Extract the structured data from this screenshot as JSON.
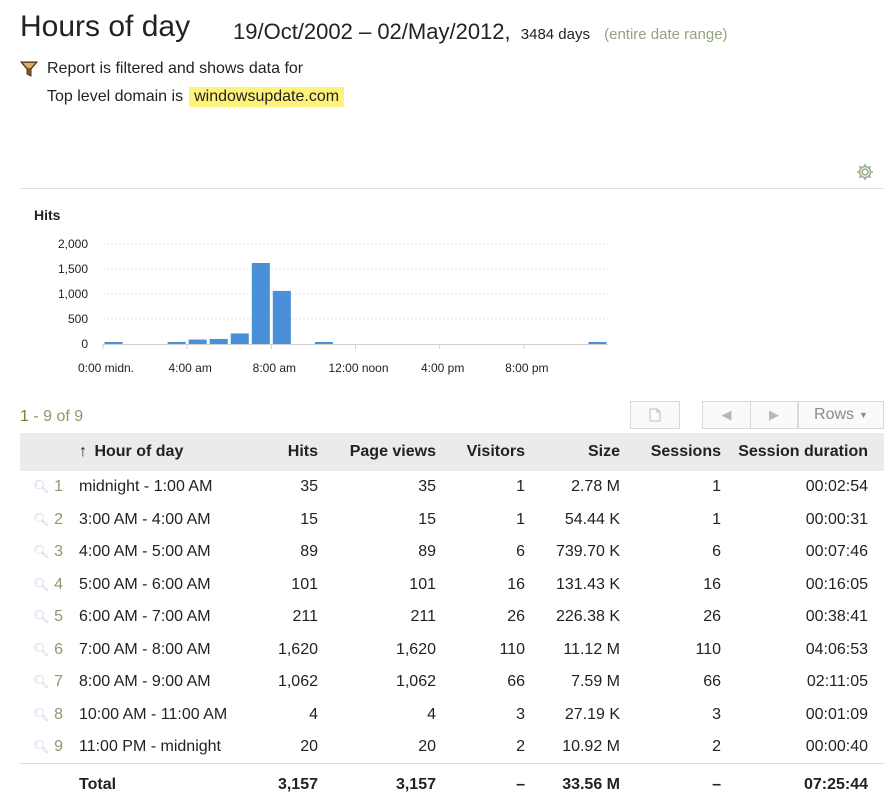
{
  "header": {
    "title": "Hours of day",
    "date_range": "19/Oct/2002 – 02/May/2012,",
    "days": "3484 days",
    "entire_range_link": "(entire date range)"
  },
  "filter": {
    "icon": "funnel-icon",
    "line1": "Report is filtered and shows data for",
    "line2_label": "Top level domain is",
    "value": "windowsupdate.com",
    "highlight_color": "#fff27a"
  },
  "chart_data": {
    "type": "bar",
    "title": "Hits",
    "xlabel": "",
    "ylabel": "",
    "ylim": [
      0,
      2000
    ],
    "yticks": [
      "2,000",
      "1,500",
      "1,000",
      "500",
      "0"
    ],
    "xtick_labels": [
      "0:00 midn.",
      "4:00 am",
      "8:00 am",
      "12:00 noon",
      "4:00 pm",
      "8:00 pm"
    ],
    "categories": [
      "0",
      "1",
      "2",
      "3",
      "4",
      "5",
      "6",
      "7",
      "8",
      "9",
      "10",
      "11",
      "12",
      "13",
      "14",
      "15",
      "16",
      "17",
      "18",
      "19",
      "20",
      "21",
      "22",
      "23"
    ],
    "values": [
      35,
      0,
      0,
      15,
      89,
      101,
      211,
      1620,
      1062,
      0,
      4,
      0,
      0,
      0,
      0,
      0,
      0,
      0,
      0,
      0,
      0,
      0,
      0,
      20
    ],
    "bar_color": "#4a90d9",
    "grid": true
  },
  "pagination": {
    "first": "1",
    "rest": " - 9 of 9",
    "rows_label": "Rows"
  },
  "table": {
    "sort_arrow": "↑",
    "columns": [
      "Hour of day",
      "Hits",
      "Page views",
      "Visitors",
      "Size",
      "Sessions",
      "Session duration"
    ],
    "rows": [
      {
        "n": "1",
        "hour": "midnight - 1:00 AM",
        "hits": "35",
        "pv": "35",
        "visitors": "1",
        "size": "2.78 M",
        "sessions": "1",
        "duration": "00:02:54"
      },
      {
        "n": "2",
        "hour": "3:00 AM - 4:00 AM",
        "hits": "15",
        "pv": "15",
        "visitors": "1",
        "size": "54.44 K",
        "sessions": "1",
        "duration": "00:00:31"
      },
      {
        "n": "3",
        "hour": "4:00 AM - 5:00 AM",
        "hits": "89",
        "pv": "89",
        "visitors": "6",
        "size": "739.70 K",
        "sessions": "6",
        "duration": "00:07:46"
      },
      {
        "n": "4",
        "hour": "5:00 AM - 6:00 AM",
        "hits": "101",
        "pv": "101",
        "visitors": "16",
        "size": "131.43 K",
        "sessions": "16",
        "duration": "00:16:05"
      },
      {
        "n": "5",
        "hour": "6:00 AM - 7:00 AM",
        "hits": "211",
        "pv": "211",
        "visitors": "26",
        "size": "226.38 K",
        "sessions": "26",
        "duration": "00:38:41"
      },
      {
        "n": "6",
        "hour": "7:00 AM - 8:00 AM",
        "hits": "1,620",
        "pv": "1,620",
        "visitors": "110",
        "size": "11.12 M",
        "sessions": "110",
        "duration": "04:06:53"
      },
      {
        "n": "7",
        "hour": "8:00 AM - 9:00 AM",
        "hits": "1,062",
        "pv": "1,062",
        "visitors": "66",
        "size": "7.59 M",
        "sessions": "66",
        "duration": "02:11:05"
      },
      {
        "n": "8",
        "hour": "10:00 AM - 11:00 AM",
        "hits": "4",
        "pv": "4",
        "visitors": "3",
        "size": "27.19 K",
        "sessions": "3",
        "duration": "00:01:09"
      },
      {
        "n": "9",
        "hour": "11:00 PM - midnight",
        "hits": "20",
        "pv": "20",
        "visitors": "2",
        "size": "10.92 M",
        "sessions": "2",
        "duration": "00:00:40"
      }
    ],
    "total": {
      "label": "Total",
      "hits": "3,157",
      "pv": "3,157",
      "visitors": "–",
      "size": "33.56 M",
      "sessions": "–",
      "duration": "07:25:44"
    }
  }
}
